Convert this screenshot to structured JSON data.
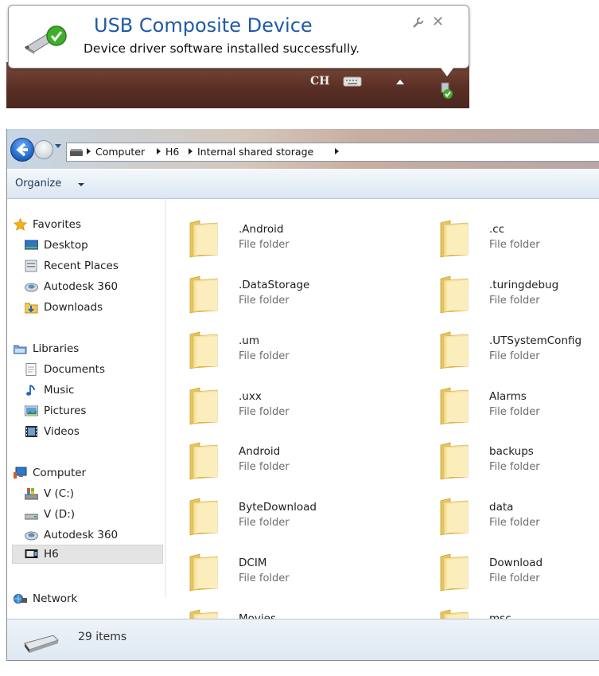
{
  "notification": {
    "title": "USB Composite Device",
    "message": "Device driver software installed successfully.",
    "tray_language": "CH"
  },
  "explorer": {
    "breadcrumb": [
      "Computer",
      "H6",
      "Internal shared storage"
    ],
    "toolbar": {
      "organize_label": "Organize"
    },
    "nav": [
      {
        "label": "Favorites",
        "icon": "star-icon"
      },
      {
        "label": "Desktop",
        "icon": "desktop-icon"
      },
      {
        "label": "Recent Places",
        "icon": "recent-places-icon"
      },
      {
        "label": "Autodesk 360",
        "icon": "autodesk-icon"
      },
      {
        "label": "Downloads",
        "icon": "downloads-icon"
      },
      {
        "label": "Libraries",
        "icon": "libraries-icon"
      },
      {
        "label": "Documents",
        "icon": "documents-icon"
      },
      {
        "label": "Music",
        "icon": "music-icon"
      },
      {
        "label": "Pictures",
        "icon": "pictures-icon"
      },
      {
        "label": "Videos",
        "icon": "videos-icon"
      },
      {
        "label": "Computer",
        "icon": "computer-icon"
      },
      {
        "label": "V (C:)",
        "icon": "system-drive-icon"
      },
      {
        "label": "V (D:)",
        "icon": "drive-icon"
      },
      {
        "label": "Autodesk 360",
        "icon": "autodesk-icon"
      },
      {
        "label": "H6",
        "icon": "device-icon",
        "selected": true
      },
      {
        "label": "Network",
        "icon": "network-icon"
      }
    ],
    "files": [
      {
        "name": ".Android",
        "type": "File folder"
      },
      {
        "name": ".cc",
        "type": "File folder"
      },
      {
        "name": ".DataStorage",
        "type": "File folder"
      },
      {
        "name": ".turingdebug",
        "type": "File folder"
      },
      {
        "name": ".um",
        "type": "File folder"
      },
      {
        "name": ".UTSystemConfig",
        "type": "File folder"
      },
      {
        "name": ".uxx",
        "type": "File folder"
      },
      {
        "name": "Alarms",
        "type": "File folder"
      },
      {
        "name": "Android",
        "type": "File folder"
      },
      {
        "name": "backups",
        "type": "File folder"
      },
      {
        "name": "ByteDownload",
        "type": "File folder"
      },
      {
        "name": "data",
        "type": "File folder"
      },
      {
        "name": "DCIM",
        "type": "File folder"
      },
      {
        "name": "Download",
        "type": "File folder"
      },
      {
        "name": "Movies",
        "type": ""
      },
      {
        "name": "msc",
        "type": ""
      }
    ],
    "status": {
      "item_count": "29 items"
    }
  }
}
